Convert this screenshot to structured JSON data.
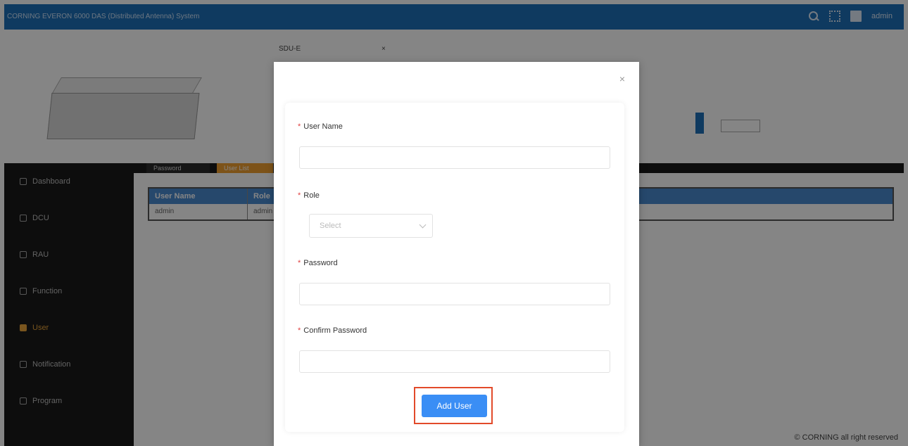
{
  "topbar": {
    "title": "CORNING EVERON 6000 DAS (Distributed Antenna) System",
    "user": "admin"
  },
  "device": {
    "info_label": "SDU-E",
    "close": "×"
  },
  "sidebar": {
    "items": [
      {
        "label": "Dashboard",
        "icon": "dashboard-icon"
      },
      {
        "label": "DCU",
        "icon": "dcu-icon"
      },
      {
        "label": "RAU",
        "icon": "rau-icon"
      },
      {
        "label": "Function",
        "icon": "function-icon"
      },
      {
        "label": "User",
        "icon": "user-icon",
        "active": true
      },
      {
        "label": "Notification",
        "icon": "notification-icon"
      },
      {
        "label": "Program",
        "icon": "program-icon"
      }
    ]
  },
  "tabs": [
    "Password",
    "User List"
  ],
  "table": {
    "headers": [
      "User Name",
      "Role"
    ],
    "rows": [
      [
        "admin",
        "admin"
      ]
    ]
  },
  "footer": "© CORNING all right reserved",
  "modal": {
    "close": "×",
    "username_label": "User Name",
    "role_label": "Role",
    "role_placeholder": "Select",
    "password_label": "Password",
    "confirm_label": "Confirm Password",
    "required_mark": "*",
    "submit_label": "Add User"
  },
  "colors": {
    "topbar": "#1d6fb8",
    "accent": "#e8a33a",
    "button": "#3a8ef5",
    "highlight": "#e24a2a"
  }
}
